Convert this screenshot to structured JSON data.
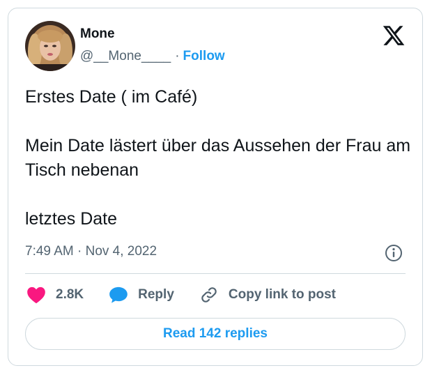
{
  "author": {
    "name": "Mone",
    "handle": "@__Mone____",
    "separator": "·",
    "follow_label": "Follow",
    "avatar_icon": "profile-photo"
  },
  "platform": {
    "logo_icon": "x-logo"
  },
  "tweet": {
    "text": "Erstes Date ( im Café)\n\nMein Date lästert über das Aussehen der Frau am Tisch nebenan\n\nletztes Date",
    "timestamp": "7:49 AM · Nov 4, 2022",
    "info_icon": "info-icon"
  },
  "actions": {
    "likes_count": "2.8K",
    "like_icon": "heart-icon",
    "reply_label": "Reply",
    "reply_icon": "speech-bubble-icon",
    "copy_label": "Copy link to post",
    "copy_icon": "link-icon"
  },
  "read_replies_label": "Read 142 replies",
  "colors": {
    "accent": "#1d9bf0",
    "like": "#f91880",
    "text": "#0f1419",
    "muted": "#536471",
    "border": "#cfd9de"
  }
}
